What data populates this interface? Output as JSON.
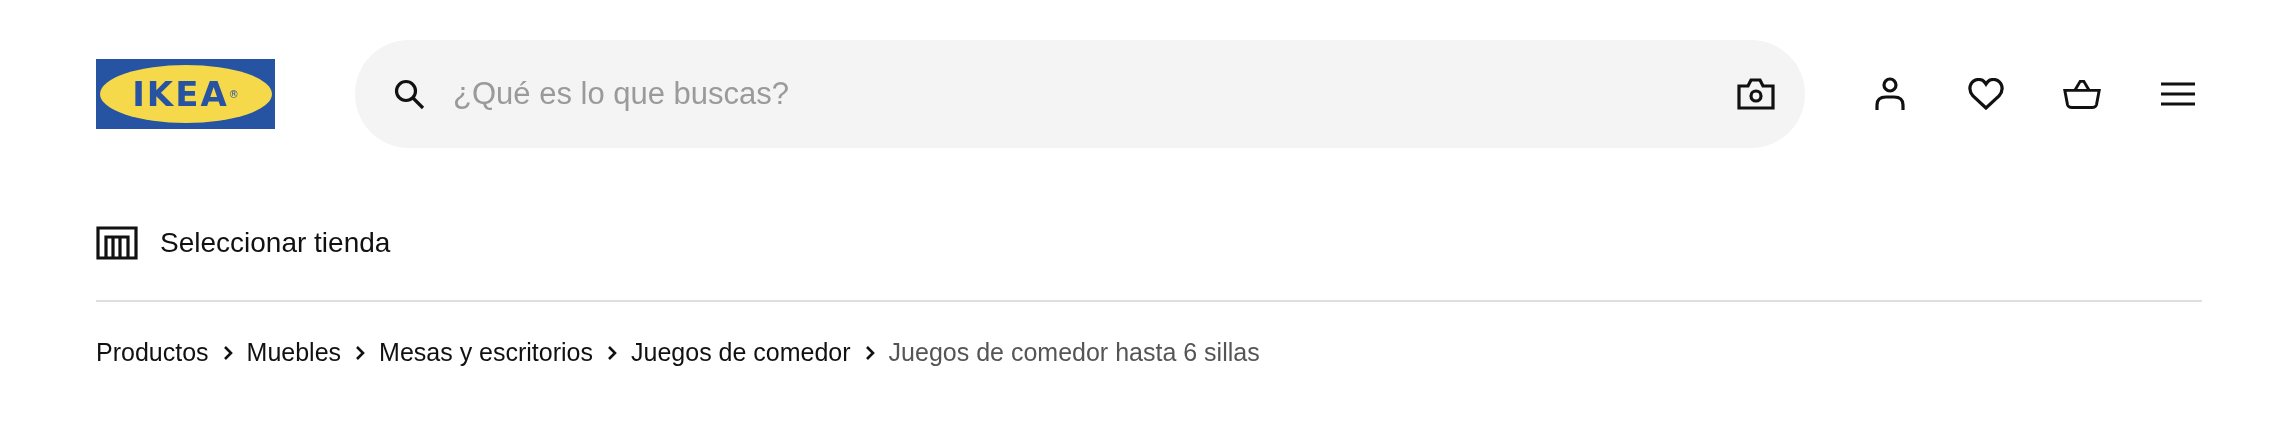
{
  "logo": {
    "text": "IKEA$^{®}$"
  },
  "search": {
    "placeholder": "¿Qué es lo que buscas?"
  },
  "header_icons": [
    {
      "kind": "profile"
    },
    {
      "kind": "favorites"
    },
    {
      "kind": "basket"
    },
    {
      "kind": "menu"
    }
  ],
  "store": {
    "label": "Seleccionar tienda"
  },
  "breadcrumb": [
    {
      "label": "Productos",
      "current": false
    },
    {
      "label": "Muebles",
      "current": false
    },
    {
      "label": "Mesas y escritorios",
      "current": false
    },
    {
      "label": "Juegos de comedor",
      "current": false
    },
    {
      "label": "Juegos de comedor hasta 6 sillas",
      "current": true
    }
  ]
}
